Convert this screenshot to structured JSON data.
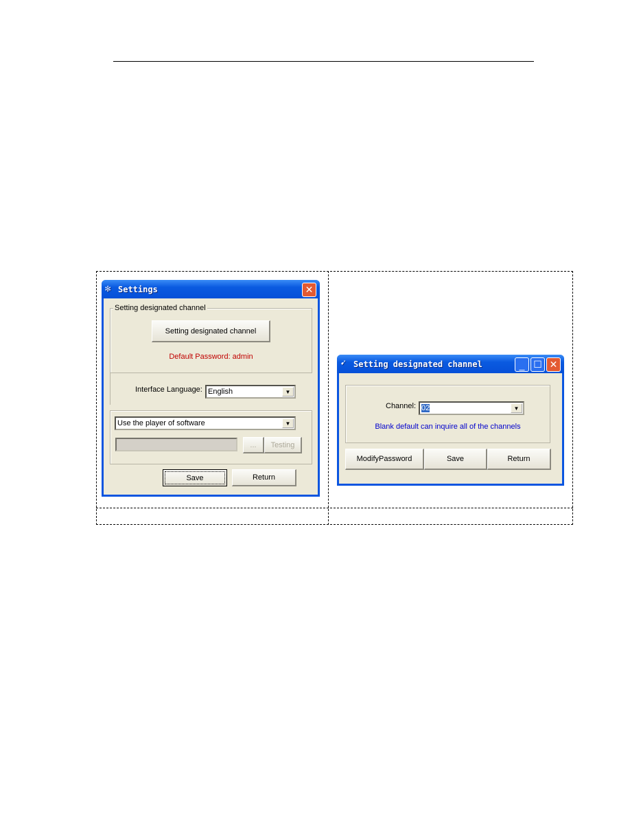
{
  "settings": {
    "title": "Settings",
    "group1_label": "Setting designated channel",
    "channel_button": "Setting designated channel",
    "default_password": "Default Password: admin",
    "language_label": "Interface Language:",
    "language_value": "English",
    "player_value": "Use the player of software",
    "path_value": "",
    "browse_button": "...",
    "testing_button": "Testing",
    "save_button": "Save",
    "return_button": "Return"
  },
  "channel_dialog": {
    "title": "Setting designated channel",
    "channel_label": "Channel:",
    "channel_value": "02",
    "hint": "Blank default can inquire all of the channels",
    "modify_button": "ModifyPassword",
    "save_button": "Save",
    "return_button": "Return"
  },
  "colors": {
    "red_text": "#c00000",
    "blue_text": "#0000cc",
    "titlebar": "#0a5ae0"
  }
}
